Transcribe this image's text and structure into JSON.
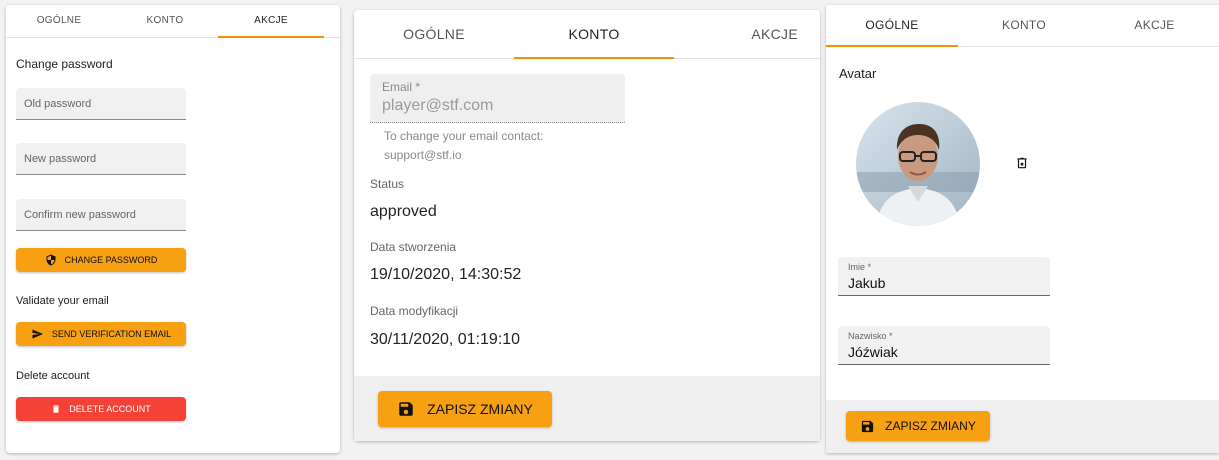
{
  "panel_left": {
    "tabs": [
      "OGÓLNE",
      "KONTO",
      "AKCJE"
    ],
    "active_tab": 2,
    "change_password": {
      "heading": "Change password",
      "old_placeholder": "Old password",
      "new_placeholder": "New password",
      "confirm_placeholder": "Confirm new password",
      "button": "CHANGE PASSWORD"
    },
    "validate_email": {
      "heading": "Validate your email",
      "button": "SEND VERIFICATION EMAIL"
    },
    "delete_account": {
      "heading": "Delete account",
      "button": "DELETE ACCOUNT"
    }
  },
  "panel_middle": {
    "tabs": [
      "OGÓLNE",
      "KONTO",
      "AKCJE"
    ],
    "active_tab": 1,
    "email_label": "Email *",
    "email_value": "player@stf.com",
    "email_helper_1": "To change your email contact:",
    "email_helper_2": "support@stf.io",
    "status_label": "Status",
    "status_value": "approved",
    "created_label": "Data stworzenia",
    "created_value": "19/10/2020, 14:30:52",
    "modified_label": "Data modyfikacji",
    "modified_value": "30/11/2020, 01:19:10",
    "save_button": "ZAPISZ ZMIANY"
  },
  "panel_right": {
    "tabs": [
      "OGÓLNE",
      "KONTO",
      "AKCJE"
    ],
    "active_tab": 0,
    "avatar_label": "Avatar",
    "first_name_label": "Imie *",
    "first_name_value": "Jakub",
    "last_name_label": "Nazwisko *",
    "last_name_value": "Jóźwiak",
    "save_button": "ZAPISZ ZMIANY"
  },
  "colors": {
    "accent": "#f39200",
    "button_orange": "#f7a012",
    "button_red": "#f44336"
  },
  "icons": [
    "shield-icon",
    "send-icon",
    "trash-icon",
    "save-icon",
    "delete-photo-icon",
    "avatar-photo"
  ]
}
